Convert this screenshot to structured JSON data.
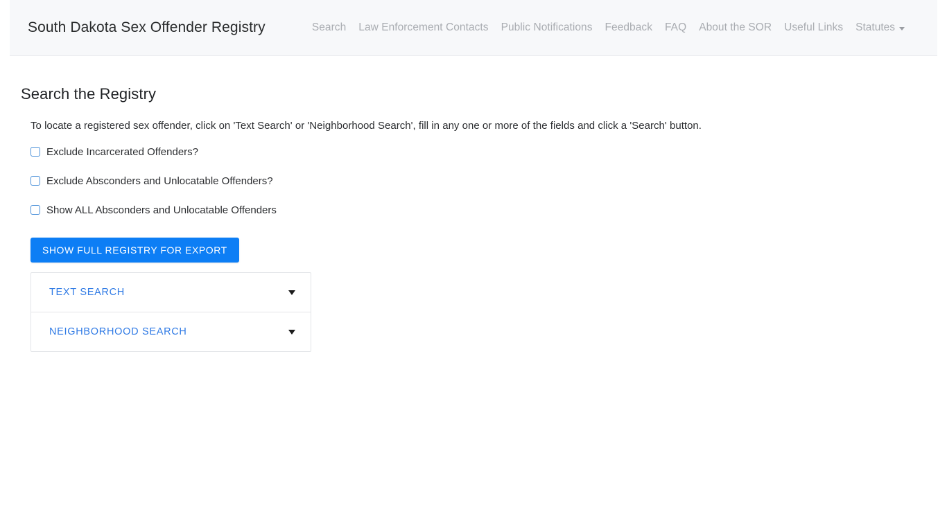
{
  "header": {
    "brand": "South Dakota Sex Offender Registry",
    "nav_items": [
      {
        "label": "Search"
      },
      {
        "label": "Law Enforcement Contacts"
      },
      {
        "label": "Public Notifications"
      },
      {
        "label": "Feedback"
      },
      {
        "label": "FAQ"
      },
      {
        "label": "About the SOR"
      },
      {
        "label": "Useful Links"
      }
    ],
    "dropdown": {
      "label": "Statutes",
      "icon": "caret-down-icon"
    },
    "background_color": "#f7f8fa",
    "link_color": "#a9acb1"
  },
  "main": {
    "page_title": "Search the Registry",
    "intro": "To locate a registered sex offender, click on 'Text Search' or 'Neighborhood Search', fill in any one or more of the fields and click a 'Search' button.",
    "checkboxes": [
      {
        "label": "Exclude Incarcerated Offenders?",
        "checked": false
      },
      {
        "label": "Exclude Absconders and Unlocatable Offenders?",
        "checked": false
      },
      {
        "label": "Show ALL Absconders and Unlocatable Offenders",
        "checked": false
      }
    ],
    "export_button": {
      "label": "SHOW FULL REGISTRY FOR EXPORT",
      "color": "#0d7ef5"
    },
    "accordion": {
      "link_color": "#2f7ae5",
      "panels": [
        {
          "label": "TEXT SEARCH",
          "icon": "caret-down-icon",
          "expanded": false
        },
        {
          "label": "NEIGHBORHOOD SEARCH",
          "icon": "caret-down-icon",
          "expanded": false
        }
      ]
    }
  }
}
